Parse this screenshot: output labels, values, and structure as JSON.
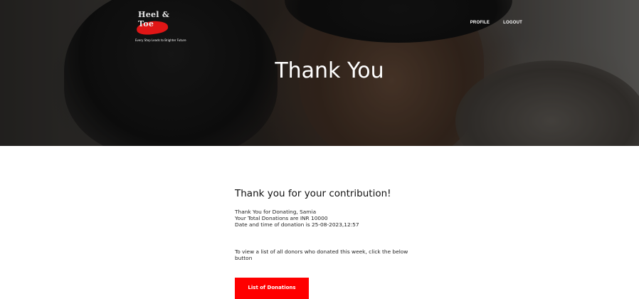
{
  "brand": {
    "logo_text": "Heel & Toe",
    "logo_tagline": "Every Step Leads to Brighter Future"
  },
  "nav": {
    "profile": "PROFILE",
    "logout": "LOGOUT"
  },
  "hero": {
    "title": "Thank You"
  },
  "main": {
    "heading": "Thank you for your contribution!",
    "details": [
      "Thank You for Donating, Samia",
      "Your Total Donations are INR 10000",
      "Date and time of donation is 25-08-2023,12:57"
    ],
    "info": "To view a list of all donors who donated this week, click the below button",
    "button_label": "List of Donations"
  },
  "colors": {
    "accent": "#ff0000",
    "text": "#222222",
    "hero_text": "#ffffff"
  }
}
